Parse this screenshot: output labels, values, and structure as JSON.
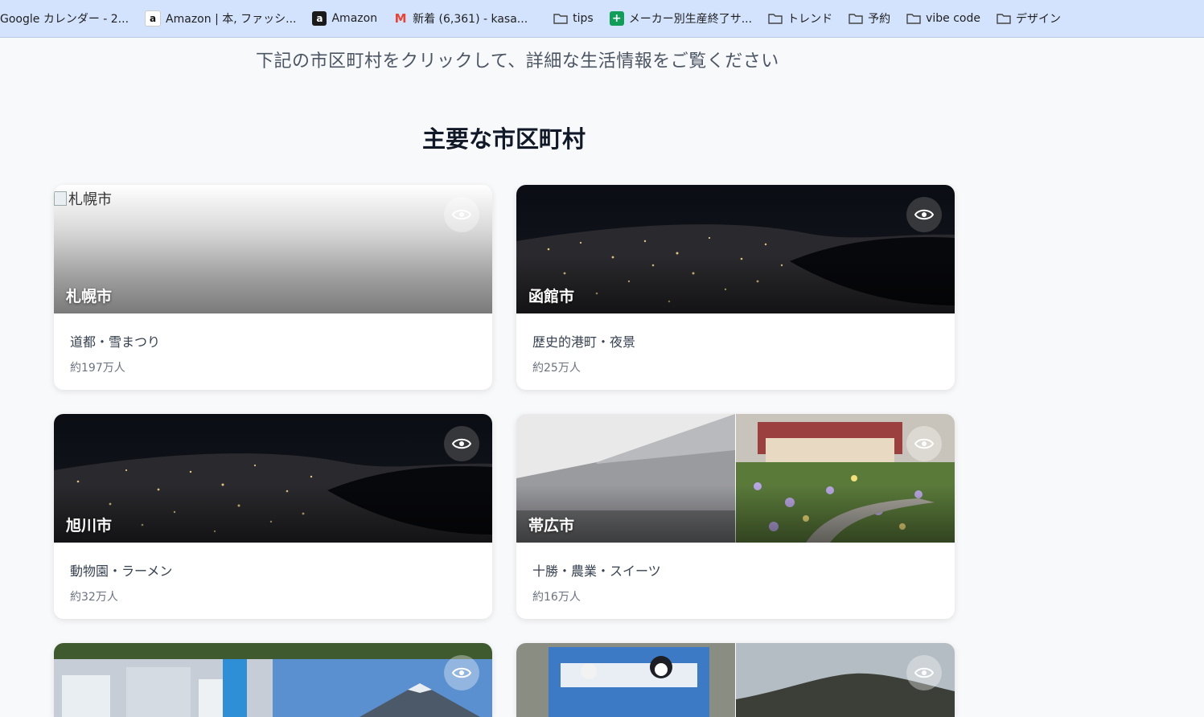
{
  "bookmarks": [
    {
      "label": "Google カレンダー - 2...",
      "icon": "none"
    },
    {
      "label": "Amazon | 本, ファッシ...",
      "icon": "amazon-icon"
    },
    {
      "label": "Amazon",
      "icon": "amazon-dark-icon"
    },
    {
      "label": "新着 (6,361) - kasa...",
      "icon": "gmail-icon"
    },
    {
      "label": "tips",
      "icon": "folder-icon"
    },
    {
      "label": "メーカー別生産終了サ...",
      "icon": "sheets-icon"
    },
    {
      "label": "トレンド",
      "icon": "folder-icon"
    },
    {
      "label": "予約",
      "icon": "folder-icon"
    },
    {
      "label": "vibe code",
      "icon": "folder-icon"
    },
    {
      "label": "デザイン",
      "icon": "folder-icon"
    }
  ],
  "page": {
    "subtitle": "下記の市区町村をクリックして、詳細な生活情報をご覧ください",
    "section_title": "主要な市区町村"
  },
  "cities": [
    {
      "name": "札幌市",
      "description": "道都・雪まつり",
      "population": "約197万人",
      "image_alt": "札幌市",
      "image": "broken"
    },
    {
      "name": "函館市",
      "description": "歴史的港町・夜景",
      "population": "約25万人",
      "image": "night-view"
    },
    {
      "name": "旭川市",
      "description": "動物園・ラーメン",
      "population": "約32万人",
      "image": "night-view"
    },
    {
      "name": "帯広市",
      "description": "十勝・農業・スイーツ",
      "population": "約16万人",
      "image": "building-garden"
    },
    {
      "name": "",
      "description": "",
      "population": "",
      "image": "city-mountain"
    },
    {
      "name": "",
      "description": "",
      "population": "",
      "image": "zoo-hill"
    }
  ],
  "colors": {
    "bookmark_bar": "#d3e3fd",
    "page_background": "#f8f9fb",
    "card_background": "#ffffff"
  }
}
